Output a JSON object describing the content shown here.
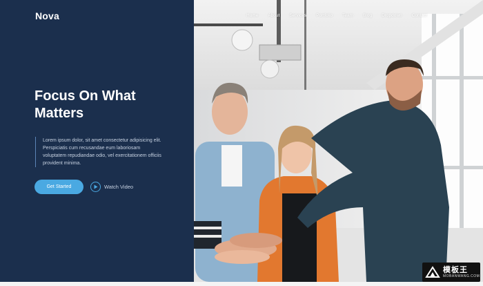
{
  "brand": {
    "logo": "Nova"
  },
  "nav": {
    "items": [
      {
        "label": "Home"
      },
      {
        "label": "About"
      },
      {
        "label": "Services"
      },
      {
        "label": "Portfolio"
      },
      {
        "label": "Team"
      },
      {
        "label": "Blog"
      },
      {
        "label": "Dropdown"
      },
      {
        "label": "Contact"
      }
    ]
  },
  "hero": {
    "headline_line1": "Focus On What",
    "headline_line2": "Matters",
    "description_lines": [
      "Lorem ipsum dolor, sit amet consectetur adipisicing elit.",
      "Perspiciatis cum recusandae eum laboriosam",
      "voluptatem repudiandae odio, vel exercitationem officiis",
      "provident minima."
    ],
    "primary_button": "Get Started",
    "video_link": "Watch Video"
  },
  "watermark": {
    "text_cn": "模板王",
    "text_en": "MOBANWANG.COM"
  },
  "colors": {
    "panel": "#1b2f4d",
    "accent": "#4aa9e2",
    "text_light": "#c7d2e2"
  },
  "icons": {
    "play": "play-icon"
  }
}
